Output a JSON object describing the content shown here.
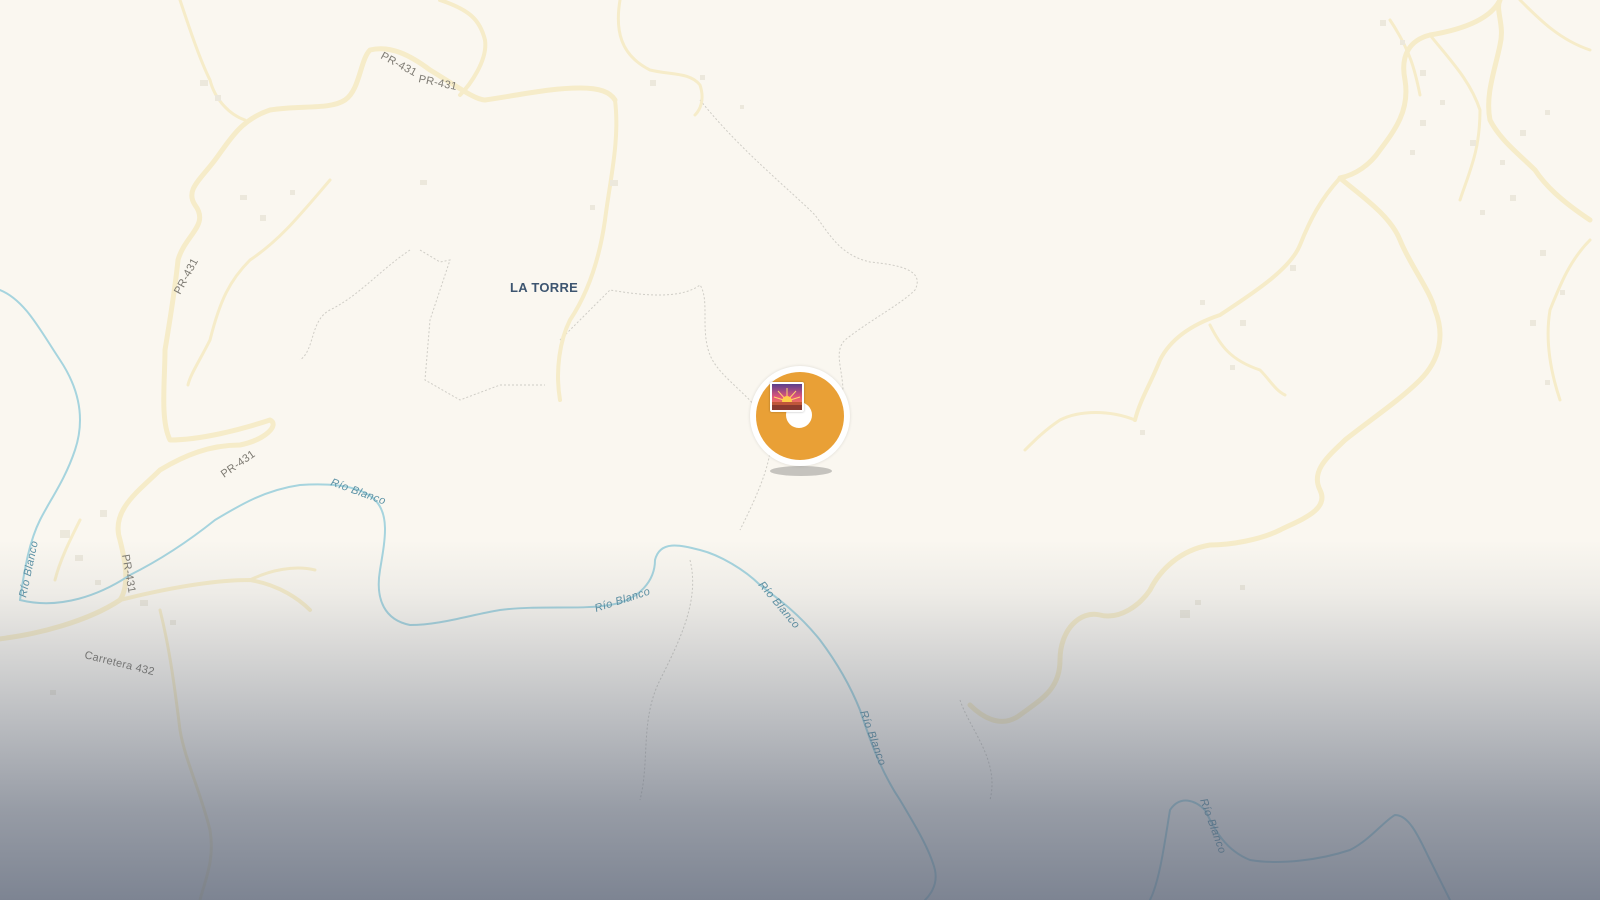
{
  "map": {
    "place_labels": [
      "LA TORRE"
    ],
    "road_labels": [
      "PR-431",
      "PR-431",
      "PR-431",
      "PR-431",
      "PR-431",
      "Carretera 432"
    ],
    "river_labels": [
      "Río Blanco",
      "Río Blanco",
      "Río Blanco",
      "Río Blanco",
      "Río Blanco",
      "Río Blanco"
    ],
    "colors": {
      "land": "#faf7f0",
      "road": "#f6ecc9",
      "river": "#a6d4de",
      "marker": "#e9a036"
    }
  },
  "marker": {
    "icon": "sunrise-photo-icon"
  }
}
